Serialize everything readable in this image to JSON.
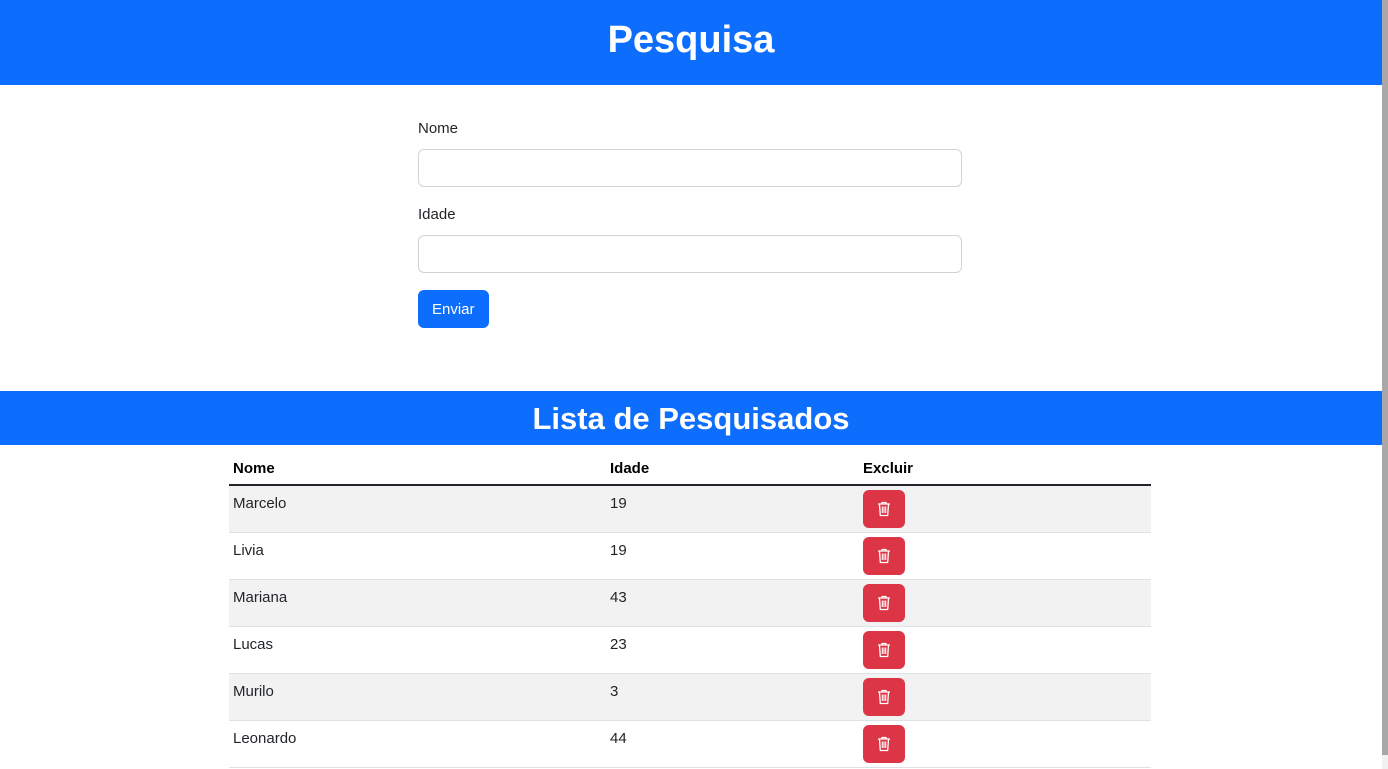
{
  "header": {
    "title": "Pesquisa"
  },
  "form": {
    "name_label": "Nome",
    "name_value": "",
    "age_label": "Idade",
    "age_value": "",
    "submit_label": "Enviar"
  },
  "list": {
    "title": "Lista de Pesquisados",
    "columns": [
      "Nome",
      "Idade",
      "Excluir"
    ],
    "rows": [
      {
        "name": "Marcelo",
        "age": "19"
      },
      {
        "name": "Livia",
        "age": "19"
      },
      {
        "name": "Mariana",
        "age": "43"
      },
      {
        "name": "Lucas",
        "age": "23"
      },
      {
        "name": "Murilo",
        "age": "3"
      },
      {
        "name": "Leonardo",
        "age": "44"
      }
    ]
  },
  "colors": {
    "primary": "#0d6efd",
    "danger": "#dc3545",
    "stripe": "#f2f2f2"
  },
  "icons": {
    "delete": "trash-icon"
  }
}
